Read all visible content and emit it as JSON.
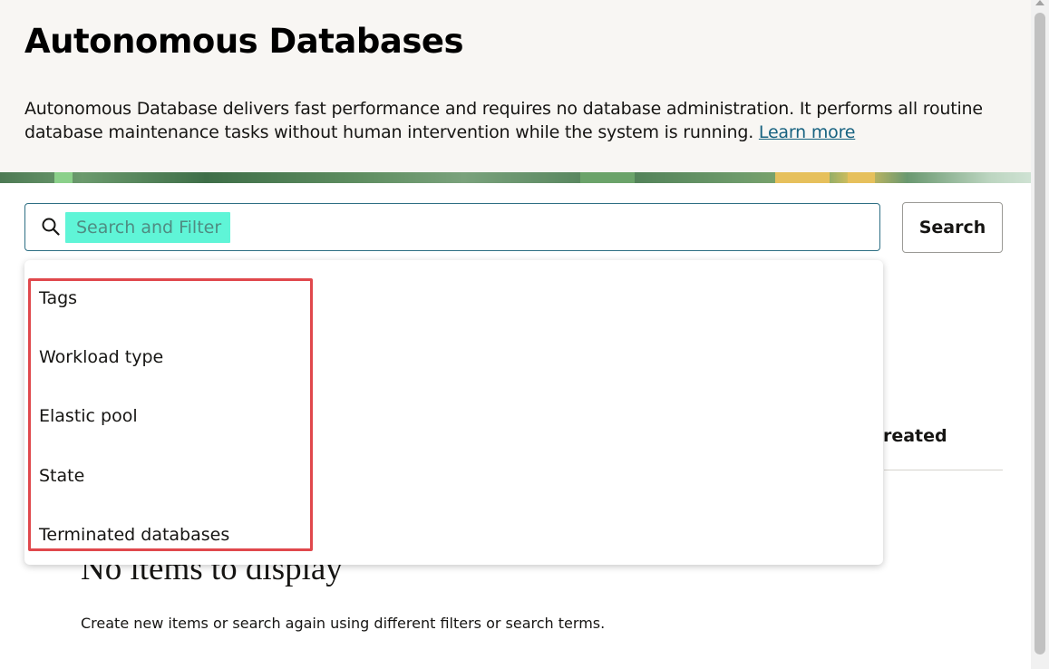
{
  "header": {
    "title": "Autonomous Databases",
    "description": "Autonomous Database delivers fast performance and requires no database administration. It performs all routine database maintenance tasks without human intervention while the system is running.",
    "learn_more_label": "Learn more"
  },
  "search": {
    "placeholder": "Search and Filter",
    "button_label": "Search"
  },
  "filter_menu": {
    "items": [
      {
        "label": "Tags"
      },
      {
        "label": "Workload type"
      },
      {
        "label": "Elastic pool"
      },
      {
        "label": "State"
      },
      {
        "label": "Terminated databases"
      }
    ]
  },
  "table": {
    "partial_column_header": "Created"
  },
  "empty_state": {
    "title": "No items to display",
    "message": "Create new items or search again using different filters or search terms."
  },
  "colors": {
    "accent_link": "#176280",
    "search_border": "#2e6f84",
    "placeholder_highlight": "#5ff5d7",
    "annotation_box": "#e0484c",
    "header_bg": "#f8f6f3"
  }
}
